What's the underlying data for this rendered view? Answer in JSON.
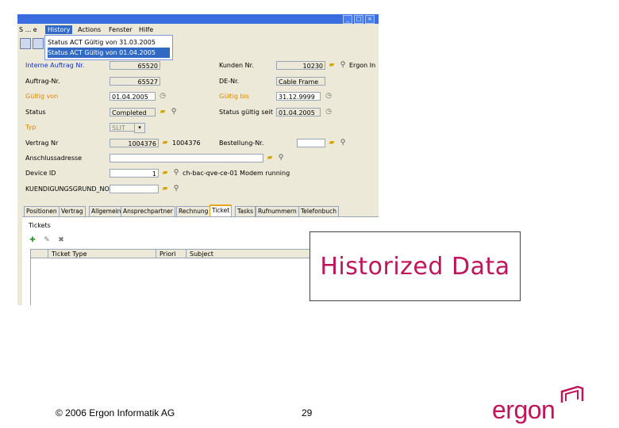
{
  "menu": {
    "items": [
      "S ... e",
      "History",
      "Actions",
      "Fenster",
      "Hilfe"
    ]
  },
  "history_dropdown": {
    "items": [
      "Status ACT Gültig von 31.03.2005",
      "Status ACT Gültig von 01.04.2005"
    ]
  },
  "form": {
    "interne_auftrag_label": "Interne Auftrag Nr.",
    "interne_auftrag_value": "65520",
    "auftrag_label": "Auftrag-Nr.",
    "auftrag_value": "65527",
    "gultig_von_label": "Gültig von",
    "gultig_von_value": "01.04.2005",
    "status_label": "Status",
    "status_value": "Completed",
    "typ_label": "Typ",
    "typ_value": "SLIT",
    "vertrag_label": "Vertrag Nr",
    "vertrag_value": "1004376",
    "vertrag_value2": "1004376",
    "anschluss_label": "Anschlussadresse",
    "device_label": "Device ID",
    "device_value": "1",
    "device_extra": "ch-bac-qve-ce-01 Modem running",
    "kuendigung_label": "KUENDIGUNGSGRUND_NO",
    "kunden_label": "Kunden Nr.",
    "kunden_value": "10230",
    "kunden_extra": "Ergon In",
    "de_label": "DE-Nr.",
    "de_value": "Cable Frame",
    "gultig_bis_label": "Gültig bis",
    "gultig_bis_value": "31.12.9999",
    "status_gultig_label": "Status gültig seit",
    "status_gultig_value": "01.04.2005",
    "bestellung_label": "Bestellung-Nr."
  },
  "tabs": [
    "Positionen",
    "Vertrag",
    "Allgemein",
    "Ansprechpartner",
    "Rechnung",
    "Ticket",
    "Tasks",
    "Rufnummern",
    "Telefonbuch"
  ],
  "tickets": {
    "label": "Tickets",
    "columns": [
      "Ticket Type",
      "Priori",
      "Subject"
    ]
  },
  "overlay_title": "Historized Data",
  "footer": {
    "copyright": "© 2006 Ergon Informatik AG",
    "page_number": "29"
  },
  "logo": {
    "text": "ergon"
  },
  "colors": {
    "brand": "#c0155b",
    "selection": "#316ac5",
    "window_bg": "#ece9d8"
  }
}
